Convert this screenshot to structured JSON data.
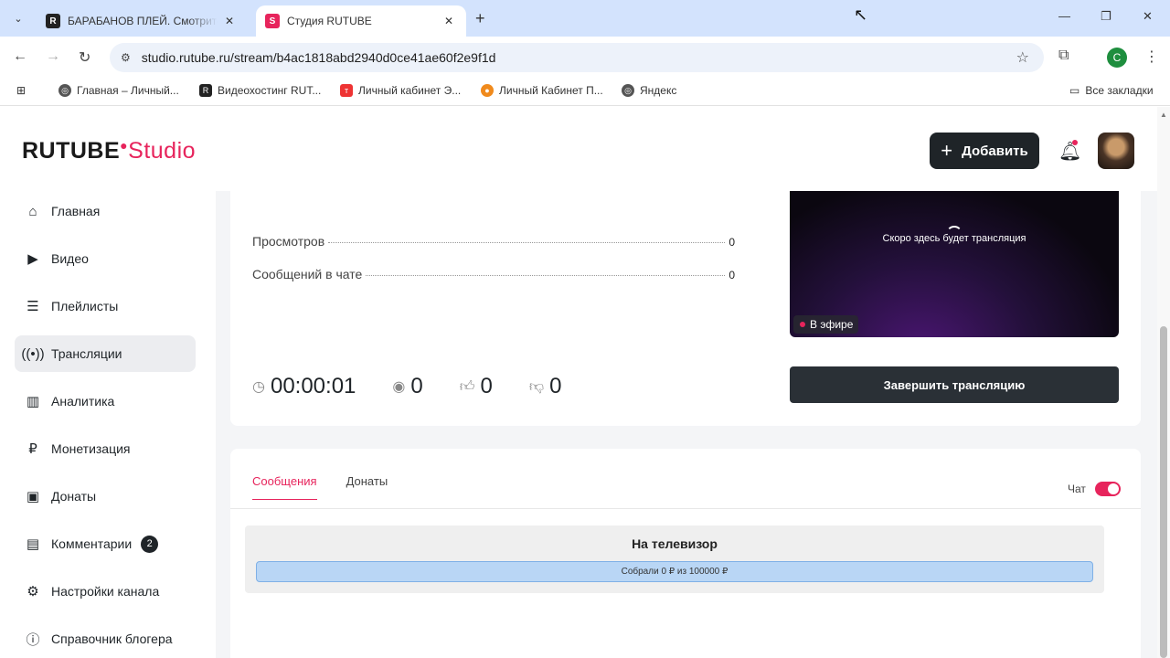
{
  "browser": {
    "tabs": [
      {
        "title": "БАРАБАНОВ ПЛЕЙ. Смотрите онлайн",
        "favicon": "R",
        "active": false
      },
      {
        "title": "Студия RUTUBE",
        "favicon": "S",
        "active": true
      }
    ],
    "url": "studio.rutube.ru/stream/b4ac1818abd2940d0ce41ae60f2e9f1d",
    "profile_initial": "C",
    "bookmarks": [
      "Главная – Личный...",
      "Видеохостинг RUT...",
      "Личный кабинет Э...",
      "Личный Кабинет П...",
      "Яндекс"
    ],
    "all_bookmarks": "Все закладки"
  },
  "header": {
    "logo_main": "RUTUBE",
    "logo_sub": "Studio",
    "add_label": "Добавить"
  },
  "sidebar": {
    "items": [
      {
        "label": "Главная",
        "icon": "home-icon"
      },
      {
        "label": "Видео",
        "icon": "video-icon"
      },
      {
        "label": "Плейлисты",
        "icon": "playlist-icon"
      },
      {
        "label": "Трансляции",
        "icon": "broadcast-icon",
        "active": true
      },
      {
        "label": "Аналитика",
        "icon": "analytics-icon"
      },
      {
        "label": "Монетизация",
        "icon": "ruble-icon"
      },
      {
        "label": "Донаты",
        "icon": "wallet-icon"
      },
      {
        "label": "Комментарии",
        "icon": "comment-icon",
        "badge": "2"
      },
      {
        "label": "Настройки канала",
        "icon": "gear-icon"
      },
      {
        "label": "Справочник блогера",
        "icon": "info-icon"
      }
    ]
  },
  "stream": {
    "stats": [
      {
        "label": "Просмотров",
        "value": "0"
      },
      {
        "label": "Сообщений в чате",
        "value": "0"
      }
    ],
    "duration": "00:00:01",
    "viewers": "0",
    "likes": "0",
    "dislikes": "0",
    "preview_text": "Скоро здесь будет трансляция",
    "live_label": "В эфире",
    "end_button": "Завершить трансляцию"
  },
  "chat": {
    "tabs": [
      "Сообщения",
      "Донаты"
    ],
    "toggle_label": "Чат",
    "toggle_on": true,
    "goal": {
      "title": "На телевизор",
      "progress_label": "Собрали 0 ₽ из 100000 ₽",
      "collected": 0,
      "target": 100000
    }
  }
}
